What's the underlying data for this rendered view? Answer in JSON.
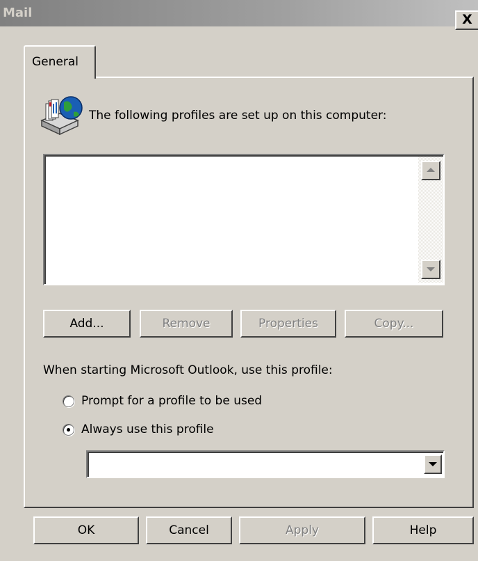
{
  "window": {
    "title": "Mail",
    "close_glyph": "X"
  },
  "tabs": [
    {
      "label": "General",
      "selected": true
    }
  ],
  "header": {
    "icon": "mail-profiles-icon",
    "text": "The following profiles are set up on this computer:"
  },
  "profiles": {
    "items": []
  },
  "profile_buttons": {
    "add": "Add...",
    "remove": "Remove",
    "properties": "Properties",
    "copy": "Copy..."
  },
  "startup": {
    "label": "When starting Microsoft Outlook, use this profile:",
    "options": [
      {
        "label": "Prompt for a profile to be used",
        "selected": false
      },
      {
        "label": "Always use this profile",
        "selected": true
      }
    ],
    "profile_select_value": ""
  },
  "dialog_buttons": {
    "ok": "OK",
    "cancel": "Cancel",
    "apply": "Apply",
    "help": "Help"
  },
  "colors": {
    "face": "#d4d0c8",
    "titlebar": "#808080",
    "disabled_text": "#808080"
  }
}
